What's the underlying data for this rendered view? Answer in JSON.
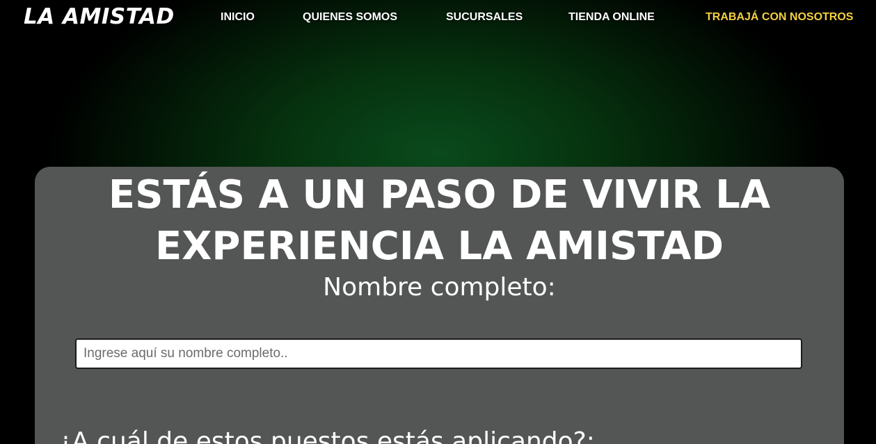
{
  "brand": {
    "logo_text": "LA AMISTAD"
  },
  "nav": {
    "items": [
      {
        "label": "INICIO"
      },
      {
        "label": "QUIENES SOMOS"
      },
      {
        "label": "SUCURSALES"
      },
      {
        "label": "TIENDA ONLINE"
      },
      {
        "label": "TRABAJÁ CON NOSOTROS",
        "active": true
      }
    ],
    "active_color": "#f4d03f"
  },
  "form": {
    "headline_line1": "ESTÁS A UN PASO DE VIVIR LA",
    "headline_line2": "EXPERIENCIA LA AMISTAD",
    "name_label": "Nombre completo:",
    "name_placeholder": "Ingrese aquí su nombre completo..",
    "name_value": "",
    "position_question": "¿A cuál de estos puestos estás aplicando?:"
  },
  "colors": {
    "card_background": "#535654",
    "page_glow": "#0a4a1c"
  }
}
